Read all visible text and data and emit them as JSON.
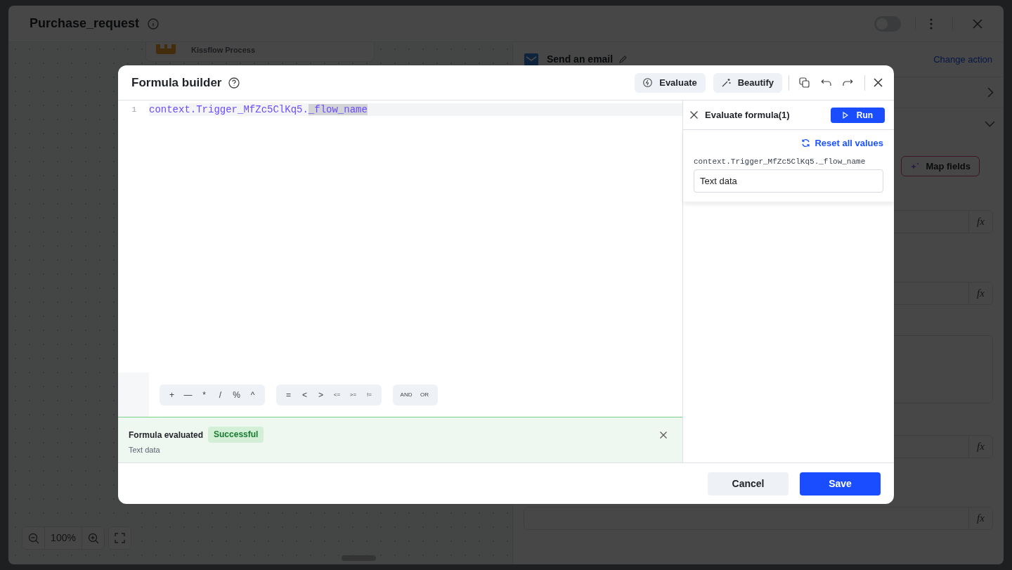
{
  "app": {
    "title": "Purchase_request",
    "toggle_on": false
  },
  "canvas": {
    "node_subtitle": "Kissflow Process",
    "zoom": "100%"
  },
  "action_panel": {
    "title": "Send an email",
    "link": "Change action",
    "map_button": "Map fields",
    "fields": [
      {
        "kind": "input",
        "button": "fx"
      },
      {
        "kind": "input",
        "button": "fx"
      },
      {
        "kind": "textarea"
      },
      {
        "kind": "input",
        "button": "fx"
      },
      {
        "kind": "input",
        "button": "fx"
      }
    ]
  },
  "modal": {
    "title": "Formula builder",
    "actions": [
      {
        "kind": "evaluate",
        "label": "Evaluate"
      },
      {
        "kind": "beautify",
        "label": "Beautify"
      }
    ],
    "lines": [
      {
        "number": "1",
        "text": "context.Trigger_MfZc5ClKq5.",
        "selection": "_flow_name"
      }
    ],
    "operator_groups": [
      {
        "kind": "math",
        "ops": [
          "+",
          "—",
          "*",
          "/",
          "%",
          "^"
        ]
      },
      {
        "kind": "compare",
        "ops": [
          "=",
          "<",
          ">",
          "<=",
          ">=",
          "!="
        ]
      },
      {
        "kind": "logic",
        "ops": [
          "AND",
          "OR"
        ]
      }
    ],
    "result": {
      "title": "Formula evaluated",
      "badge": "Successful",
      "value": "Text data"
    },
    "evaluate_panel": {
      "title": "Evaluate formula(1)",
      "run": "Run",
      "reset": "Reset all values",
      "variables": [
        {
          "name": "context.Trigger_MfZc5ClKq5._flow_name",
          "value": "Text data"
        }
      ]
    },
    "footer": {
      "cancel": "Cancel",
      "save": "Save"
    }
  }
}
